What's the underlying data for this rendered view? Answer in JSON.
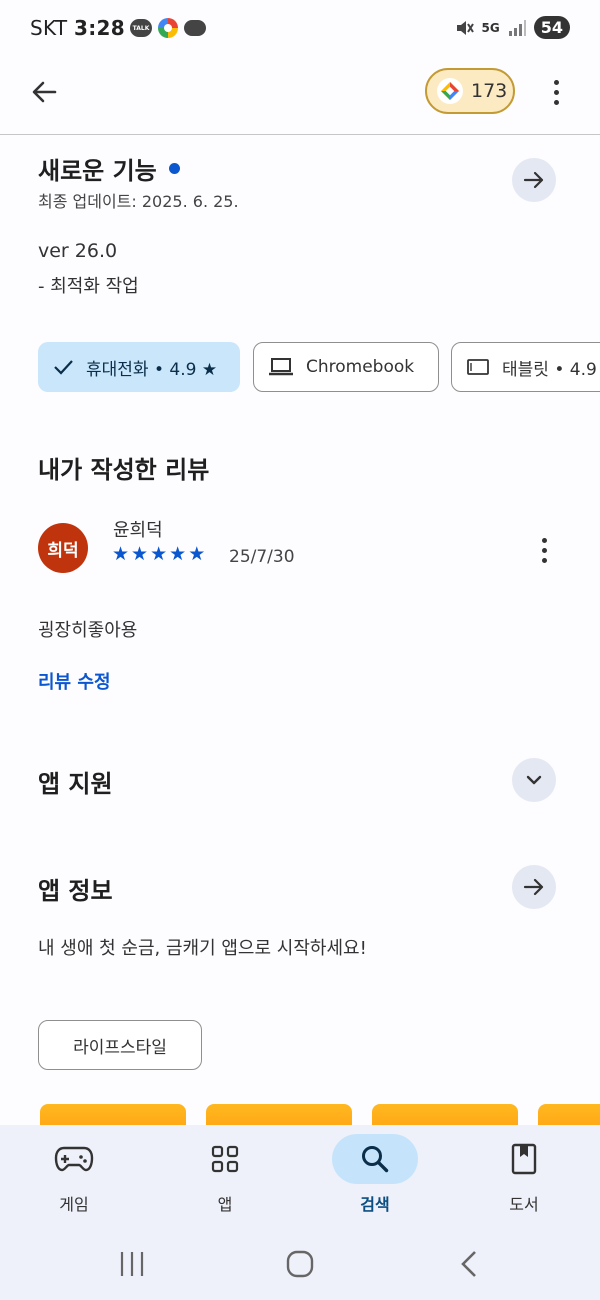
{
  "status_bar": {
    "carrier": "SKT",
    "time": "3:28",
    "talk_badge": "TALK",
    "network": "5G",
    "battery": "54"
  },
  "top_bar": {
    "points": "173"
  },
  "whats_new": {
    "title": "새로운 기능",
    "updated": "최종 업데이트: 2025. 6. 25.",
    "version": "ver 26.0",
    "notes": "- 최적화 작업"
  },
  "device_chips": [
    {
      "label": "휴대전화 • 4.9 ★",
      "icon": "check-icon",
      "selected": true
    },
    {
      "label": "Chromebook",
      "icon": "laptop-icon",
      "selected": false
    },
    {
      "label": "태블릿 • 4.9",
      "icon": "tablet-icon",
      "selected": false
    }
  ],
  "my_review": {
    "title": "내가 작성한 리뷰",
    "avatar_text": "희덕",
    "avatar_color": "#c0340d",
    "reviewer": "윤희덕",
    "stars": 5,
    "date": "25/7/30",
    "text": "굉장히좋아용",
    "edit_label": "리뷰 수정"
  },
  "app_support": {
    "title": "앱 지원"
  },
  "app_info": {
    "title": "앱 정보",
    "description": "내 생애 첫 순금, 금캐기 앱으로 시작하세요!"
  },
  "category": {
    "label": "라이프스타일"
  },
  "bottom_nav": [
    {
      "label": "게임",
      "icon": "gamepad-icon",
      "active": false
    },
    {
      "label": "앱",
      "icon": "apps-grid-icon",
      "active": false
    },
    {
      "label": "검색",
      "icon": "search-icon",
      "active": true
    },
    {
      "label": "도서",
      "icon": "book-icon",
      "active": false
    }
  ],
  "colors": {
    "accent": "#0b57d0",
    "selected_chip": "#c9e6fb",
    "nav_background": "#eef1fa",
    "points_chip": "#fcebc2"
  }
}
